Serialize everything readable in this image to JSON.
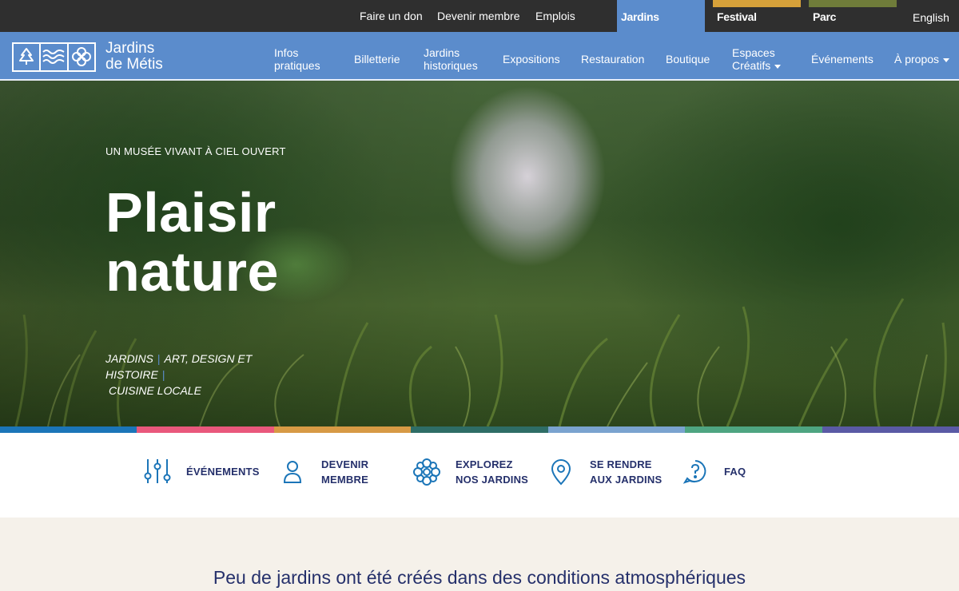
{
  "utility_nav": {
    "links": [
      "Faire un don",
      "Devenir membre",
      "Emplois"
    ],
    "site_tabs": [
      {
        "label": "Jardins",
        "accent": "#5b8ccc",
        "active": true
      },
      {
        "label": "Festival",
        "accent": "#d6a13a",
        "active": false
      },
      {
        "label": "Parc",
        "accent": "#6f7c3a",
        "active": false
      }
    ],
    "language": "English"
  },
  "brand": {
    "line1": "Jardins",
    "line2": "de Métis",
    "color": "#5b8ccc"
  },
  "main_nav": [
    {
      "label": "Infos",
      "label2": "pratiques"
    },
    {
      "label": "Billetterie"
    },
    {
      "label": "Jardins",
      "label2": "historiques"
    },
    {
      "label": "Expositions"
    },
    {
      "label": "Restauration"
    },
    {
      "label": "Boutique"
    },
    {
      "label": "Espaces",
      "label2": "Créatifs",
      "dropdown": true
    },
    {
      "label": "Événements"
    },
    {
      "label": "À propos",
      "dropdown": true
    }
  ],
  "hero": {
    "eyebrow": "UN MUSÉE VIVANT À CIEL OUVERT",
    "title_line1": "Plaisir",
    "title_line2": "nature",
    "tags": [
      "JARDINS",
      "ART, DESIGN ET HISTOIRE",
      "CUISINE LOCALE"
    ]
  },
  "color_strip": [
    "#1b75b8",
    "#e9587c",
    "#d79a45",
    "#2e6d66",
    "#7aa3cf",
    "#4ea581",
    "#5a5aa5"
  ],
  "quick_links": [
    {
      "icon": "sliders-icon",
      "line1": "ÉVÉNEMENTS",
      "line2": ""
    },
    {
      "icon": "user-icon",
      "line1": "DEVENIR",
      "line2": "MEMBRE"
    },
    {
      "icon": "flower-icon",
      "line1": "EXPLOREZ",
      "line2": "NOS JARDINS"
    },
    {
      "icon": "map-pin-icon",
      "line1": "SE RENDRE",
      "line2": "AUX JARDINS"
    },
    {
      "icon": "question-icon",
      "line1": "FAQ",
      "line2": ""
    }
  ],
  "intro": {
    "text": "Peu de jardins ont été créés dans des conditions atmosphériques"
  },
  "colors": {
    "dark_bar": "#2f2f2f",
    "nav_blue": "#5b8ccc",
    "navy_text": "#25306b",
    "cream": "#f5f1ea",
    "icon_blue": "#1b75b8"
  }
}
